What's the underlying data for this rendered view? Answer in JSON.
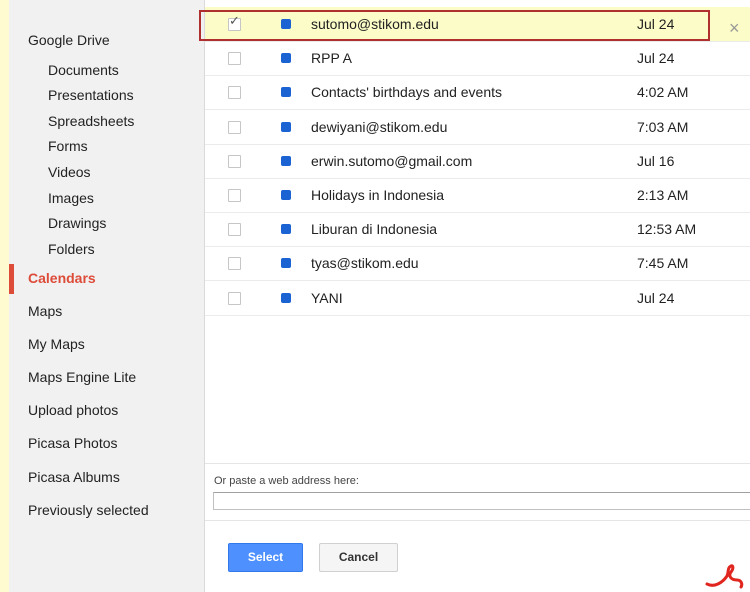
{
  "sidebar": {
    "google_drive": "Google Drive",
    "drive_items": [
      "Documents",
      "Presentations",
      "Spreadsheets",
      "Forms",
      "Videos",
      "Images",
      "Drawings",
      "Folders"
    ],
    "calendars": "Calendars",
    "items": [
      "Maps",
      "My Maps",
      "Maps Engine Lite",
      "Upload photos",
      "Picasa Photos",
      "Picasa Albums",
      "Previously selected"
    ]
  },
  "list": {
    "rows": [
      {
        "name": "sutomo@stikom.edu",
        "date": "Jul 24",
        "checked": true
      },
      {
        "name": "RPP A",
        "date": "Jul 24",
        "checked": false
      },
      {
        "name": "Contacts' birthdays and events",
        "date": "4:02 AM",
        "checked": false
      },
      {
        "name": "dewiyani@stikom.edu",
        "date": "7:03 AM",
        "checked": false
      },
      {
        "name": "erwin.sutomo@gmail.com",
        "date": "Jul 16",
        "checked": false
      },
      {
        "name": "Holidays in Indonesia",
        "date": "2:13 AM",
        "checked": false
      },
      {
        "name": "Liburan di Indonesia",
        "date": "12:53 AM",
        "checked": false
      },
      {
        "name": "tyas@stikom.edu",
        "date": "7:45 AM",
        "checked": false
      },
      {
        "name": "YANI",
        "date": "Jul 24",
        "checked": false
      }
    ]
  },
  "url": {
    "label": "Or paste a web address here:",
    "value": ""
  },
  "buttons": {
    "select": "Select",
    "cancel": "Cancel",
    "close": "×"
  },
  "colors": {
    "accent": "#4d90fe",
    "active_nav": "#dd4b39",
    "calendar_dot": "#1b63d2",
    "selected_row": "#fcfcc8"
  }
}
